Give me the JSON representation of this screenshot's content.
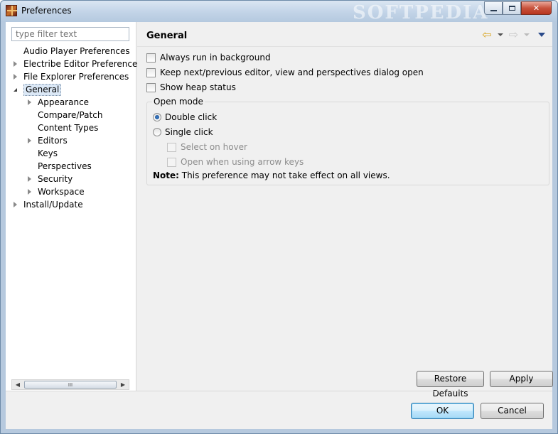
{
  "window": {
    "title": "Preferences",
    "watermark": "SOFTPEDIA"
  },
  "filter": {
    "placeholder": "type filter text"
  },
  "tree": [
    {
      "label": "Audio Player Preferences",
      "level": 0,
      "expander": "none",
      "selected": false
    },
    {
      "label": "Electribe Editor Preferences",
      "level": 0,
      "expander": "collapsed",
      "selected": false
    },
    {
      "label": "File Explorer Preferences",
      "level": 0,
      "expander": "collapsed",
      "selected": false
    },
    {
      "label": "General",
      "level": 0,
      "expander": "expanded",
      "selected": true
    },
    {
      "label": "Appearance",
      "level": 1,
      "expander": "collapsed",
      "selected": false
    },
    {
      "label": "Compare/Patch",
      "level": 1,
      "expander": "none",
      "selected": false
    },
    {
      "label": "Content Types",
      "level": 1,
      "expander": "none",
      "selected": false
    },
    {
      "label": "Editors",
      "level": 1,
      "expander": "collapsed",
      "selected": false
    },
    {
      "label": "Keys",
      "level": 1,
      "expander": "none",
      "selected": false
    },
    {
      "label": "Perspectives",
      "level": 1,
      "expander": "none",
      "selected": false
    },
    {
      "label": "Security",
      "level": 1,
      "expander": "collapsed",
      "selected": false
    },
    {
      "label": "Workspace",
      "level": 1,
      "expander": "collapsed",
      "selected": false
    },
    {
      "label": "Install/Update",
      "level": 0,
      "expander": "collapsed",
      "selected": false
    }
  ],
  "page": {
    "title": "General",
    "checkboxes": {
      "always_run": "Always run in background",
      "keep_next_prev": "Keep next/previous editor, view and perspectives dialog open",
      "show_heap": "Show heap status"
    },
    "open_mode": {
      "title": "Open mode",
      "double_click": "Double click",
      "single_click": "Single click",
      "selected": "Double click",
      "select_on_hover": "Select on hover",
      "open_arrow_keys": "Open when using arrow keys",
      "note_label": "Note:",
      "note_text": "This preference may not take effect on all views."
    }
  },
  "buttons": {
    "restore_defaults": "Restore Defaults",
    "apply": "Apply",
    "ok": "OK",
    "cancel": "Cancel"
  },
  "scrollbar": {
    "thumb_grip": "III"
  }
}
